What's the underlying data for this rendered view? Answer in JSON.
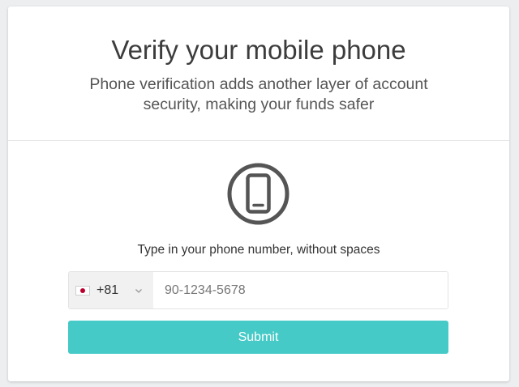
{
  "header": {
    "title": "Verify your mobile phone",
    "subtitle": "Phone verification adds another layer of account security, making your funds safer"
  },
  "icon": {
    "name": "mobile-phone-icon"
  },
  "form": {
    "instruction": "Type in your phone number, without spaces",
    "country": {
      "flag": "japan-flag-icon",
      "dial_code": "+81"
    },
    "phone_input": {
      "value": "",
      "placeholder": "90-1234-5678"
    },
    "submit_label": "Submit"
  },
  "colors": {
    "accent": "#45cac7",
    "icon": "#555555"
  }
}
